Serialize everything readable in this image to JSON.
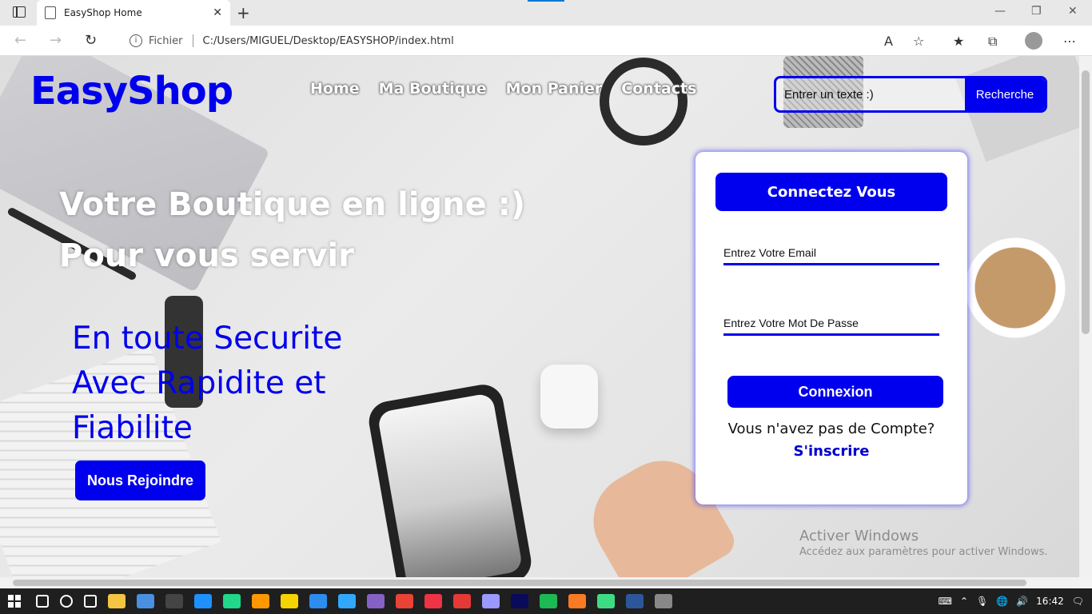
{
  "browser": {
    "tab_title": "EasyShop Home",
    "tab_close": "✕",
    "new_tab": "+",
    "url_scheme_label": "Fichier",
    "url": "C:/Users/MIGUEL/Desktop/EASYSHOP/index.html",
    "window_controls": [
      "—",
      "❐",
      "✕"
    ]
  },
  "page": {
    "brand": "EasyShop",
    "nav": [
      "Home",
      "Ma Boutique",
      "Mon Panier",
      "Contacts"
    ],
    "search": {
      "placeholder": "Entrer un texte :)",
      "button": "Recherche"
    },
    "hero": {
      "line1": "Votre Boutique en ligne :)",
      "line2": "Pour vous servir",
      "sub1": "En toute Securite",
      "sub2": "Avec Rapidite et",
      "sub3": "Fiabilite",
      "join_button": "Nous Rejoindre"
    },
    "login": {
      "title": "Connectez Vous",
      "email_placeholder": "Entrez Votre Email",
      "password_placeholder": "Entrez Votre Mot De Passe",
      "submit": "Connexion",
      "no_account": "Vous n'avez pas de Compte?",
      "signup": "S'inscrire"
    }
  },
  "watermark": {
    "line1": "Activer Windows",
    "line2": "Accédez aux paramètres pour activer Windows."
  },
  "taskbar": {
    "time": "16:42",
    "icons": [
      "search-icon",
      "cortana-icon",
      "task-view-icon",
      "file-explorer-icon",
      "store-icon",
      "terminal-icon",
      "edge-icon",
      "pycharm-icon",
      "sublime-icon",
      "app-icon",
      "vscode-icon",
      "photoshop-icon",
      "visual-studio-icon",
      "chrome-icon",
      "app2-icon",
      "record-icon",
      "premiere-icon",
      "animate-icon",
      "spotify-icon",
      "xampp-icon",
      "android-studio-icon",
      "word-icon",
      "app3-icon"
    ]
  },
  "colors": {
    "accent": "#0000ee",
    "white": "#ffffff"
  }
}
